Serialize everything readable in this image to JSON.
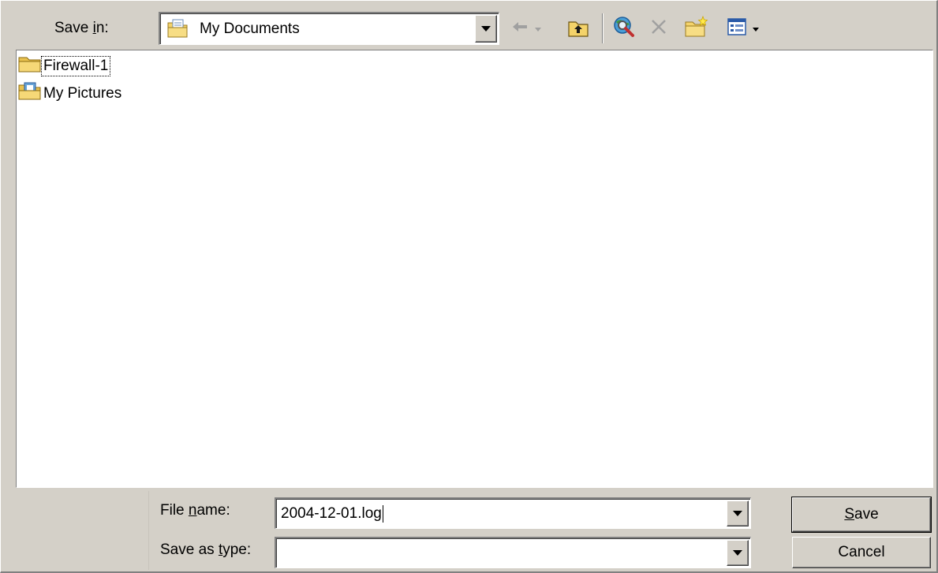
{
  "dialog": {
    "save_in_label_pre": "Save ",
    "save_in_label_key": "i",
    "save_in_label_post": "n:",
    "save_in_value": "My Documents",
    "items": [
      {
        "name": "Firewall-1",
        "icon": "folder-icon"
      },
      {
        "name": "My Pictures",
        "icon": "pictures-folder-icon"
      }
    ],
    "file_name_label_pre": "File ",
    "file_name_label_key": "n",
    "file_name_label_post": "ame:",
    "file_name_value": "2004-12-01.log",
    "save_type_label_pre": "Save as ",
    "save_type_label_key": "t",
    "save_type_label_post": "ype:",
    "save_type_value": "",
    "save_button_key": "S",
    "save_button_rest": "ave",
    "cancel_label": "Cancel"
  },
  "toolbar": {
    "icons": [
      "back-arrow-icon",
      "up-folder-icon",
      "search-web-icon",
      "delete-icon",
      "new-folder-icon",
      "views-menu-icon"
    ]
  },
  "colors": {
    "face": "#d4d0c8",
    "shadow": "#808080",
    "folder": "#f4d36a"
  }
}
